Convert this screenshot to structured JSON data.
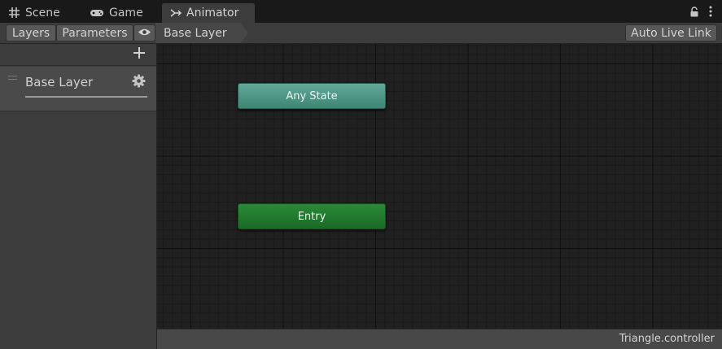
{
  "tabs": [
    {
      "label": "Scene",
      "icon": "hash-icon",
      "active": false
    },
    {
      "label": "Game",
      "icon": "gamepad-icon",
      "active": false
    },
    {
      "label": "Animator",
      "icon": "animator-icon",
      "active": true
    }
  ],
  "window_controls": {
    "lock_icon": "lock-icon",
    "menu_icon": "kebab-menu-icon"
  },
  "toolbar": {
    "layers_label": "Layers",
    "parameters_label": "Parameters",
    "eye_icon": "eye-icon",
    "breadcrumb": "Base Layer",
    "auto_live_link_label": "Auto Live Link"
  },
  "layers_panel": {
    "add_icon": "plus-icon",
    "items": [
      {
        "name": "Base Layer",
        "settings_icon": "gear-icon"
      }
    ]
  },
  "graph": {
    "nodes": [
      {
        "label": "Any State",
        "color": "#4f9887"
      },
      {
        "label": "Entry",
        "color": "#217a2f"
      }
    ]
  },
  "status": {
    "file": "Triangle.controller"
  },
  "colors": {
    "background": "#202020",
    "panel": "#3c3c3c",
    "selected_layer": "#4a4a4a"
  }
}
